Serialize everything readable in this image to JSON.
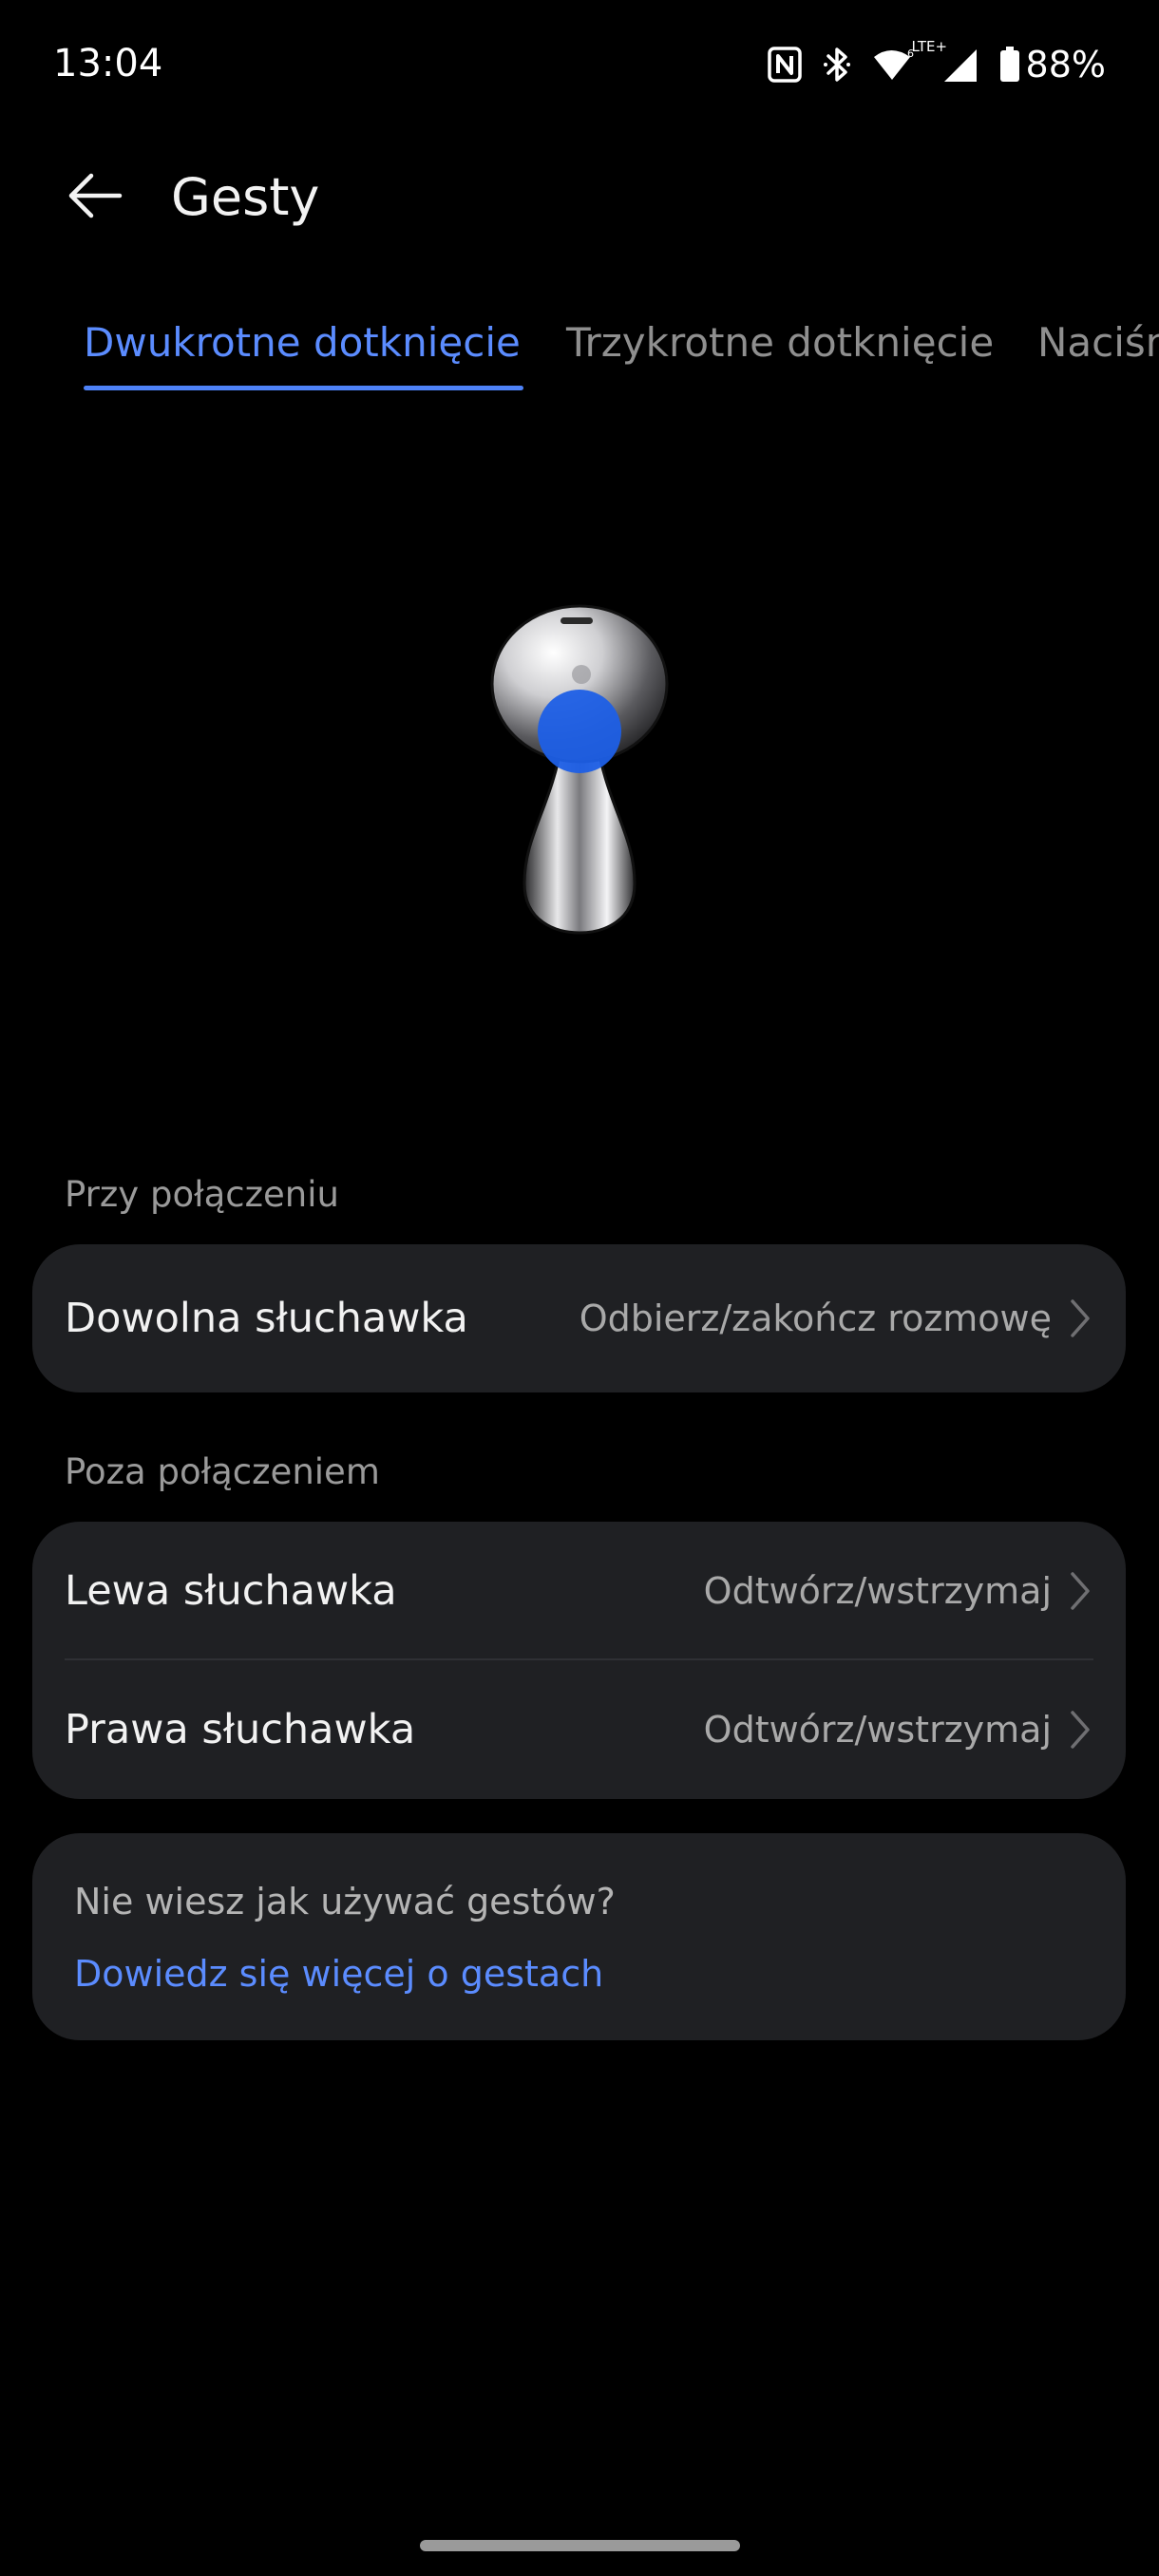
{
  "status_bar": {
    "time": "13:04",
    "network_label": "LTE+",
    "battery": "88%",
    "icons": [
      "nfc-icon",
      "bluetooth-icon",
      "wifi-icon",
      "cellular-signal-icon",
      "battery-icon"
    ]
  },
  "header": {
    "title": "Gesty",
    "back_icon": "arrow-left-icon"
  },
  "tabs": [
    {
      "label": "Dwukrotne dotknięcie",
      "active": true
    },
    {
      "label": "Trzykrotne dotknięcie",
      "active": false
    },
    {
      "label": "Naciśnij i przytrzymaj",
      "active": false
    }
  ],
  "illustration": {
    "name": "earbud-image",
    "highlight_color": "#1e5fe6"
  },
  "sections": {
    "during_call": {
      "title": "Przy połączeniu",
      "rows": [
        {
          "label": "Dowolna słuchawka",
          "value": "Odbierz/zakończ rozmowę"
        }
      ]
    },
    "outside_call": {
      "title": "Poza połączeniem",
      "rows": [
        {
          "label": "Lewa słuchawka",
          "value": "Odtwórz/wstrzymaj"
        },
        {
          "label": "Prawa słuchawka",
          "value": "Odtwórz/wstrzymaj"
        }
      ]
    }
  },
  "help": {
    "question": "Nie wiesz jak używać gestów?",
    "link": "Dowiedz się więcej o gestach"
  },
  "colors": {
    "accent": "#5b8cff",
    "background": "#000000",
    "card": "#1f2023"
  }
}
